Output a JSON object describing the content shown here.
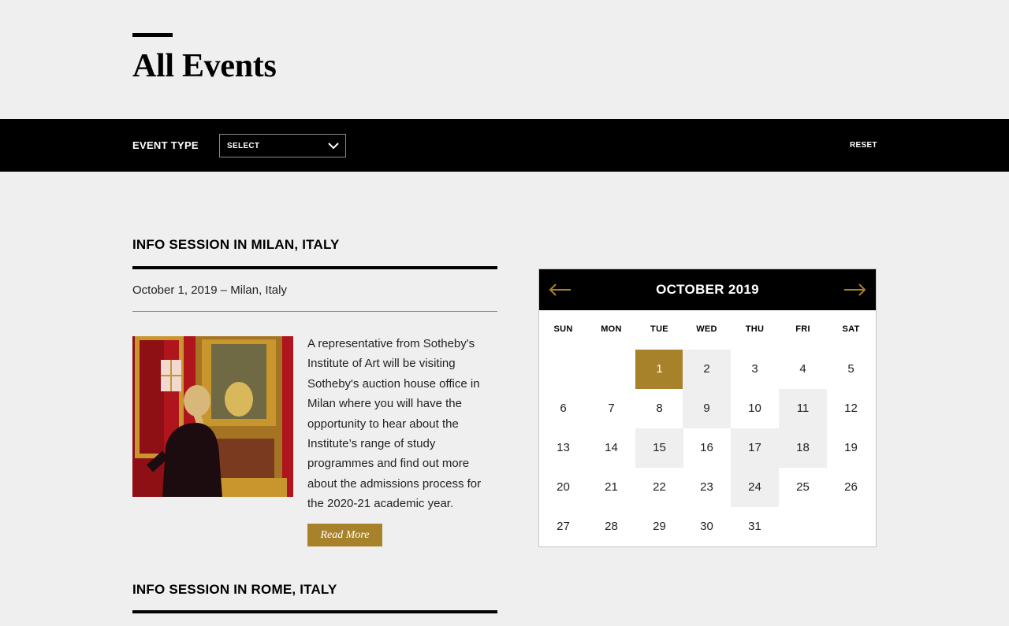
{
  "page": {
    "title": "All Events"
  },
  "filter": {
    "label": "EVENT TYPE",
    "select_value": "SELECT",
    "reset_label": "RESET"
  },
  "events": [
    {
      "title": "INFO SESSION IN MILAN, ITALY",
      "meta": "October 1, 2019 – Milan, Italy",
      "description": "A representative from Sotheby's Institute of Art will be visiting Sotheby's auction house office in Milan where you will have the opportunity to hear about the Institute’s range of study programmes and find out more about the admissions process for the 2020-21 academic year.",
      "read_more": "Read More"
    },
    {
      "title": "INFO SESSION IN ROME, ITALY"
    }
  ],
  "calendar": {
    "month_label": "OCTOBER 2019",
    "weekdays": [
      "SUN",
      "MON",
      "TUE",
      "WED",
      "THU",
      "FRI",
      "SAT"
    ],
    "first_weekday_index": 2,
    "days_in_month": 31,
    "selected_day": 1,
    "event_days": [
      2,
      9,
      11,
      15,
      17,
      18,
      24
    ],
    "prev_icon": "arrow-left-icon",
    "next_icon": "arrow-right-icon"
  },
  "colors": {
    "accent_gold": "#a8822a",
    "bar_black": "#000000",
    "page_bg": "#efefef",
    "event_day_bg": "#efefef"
  }
}
